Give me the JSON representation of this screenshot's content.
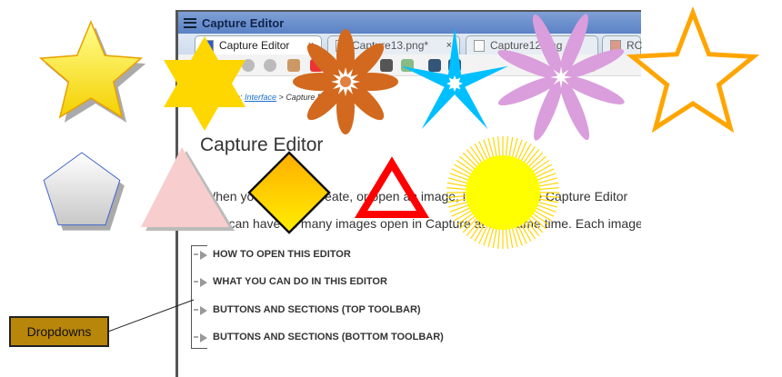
{
  "window": {
    "title": "Capture Editor"
  },
  "tabs": [
    {
      "label": "Capture Editor",
      "close": "×"
    },
    {
      "label": "Capture13.png*",
      "close": "×"
    },
    {
      "label": "Capture12.png",
      "close": ""
    },
    {
      "label": "RC",
      "close": ""
    }
  ],
  "breadcrumb": {
    "prefix": "re: ",
    "link": "Interface",
    "sep": " > ",
    "current": "Capture Editor"
  },
  "content": {
    "heading": "Capture Editor",
    "para1": "When you capture, create, or open an image, it opens in the Capture Editor",
    "para2": "You can have as many images open in Capture at the same time. Each image",
    "dropdowns": [
      "HOW TO OPEN THIS EDITOR",
      "WHAT YOU CAN DO IN THIS EDITOR",
      "BUTTONS AND SECTIONS (TOP TOOLBAR)",
      "BUTTONS AND SECTIONS (BOTTOM TOOLBAR)"
    ]
  },
  "callout": {
    "label": "Dropdowns",
    "color": "#b8860b"
  }
}
